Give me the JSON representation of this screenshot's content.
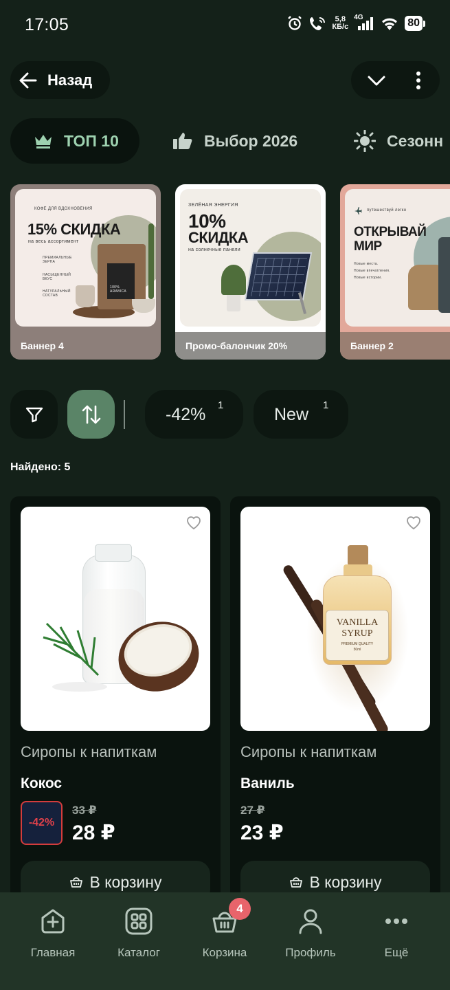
{
  "status_bar": {
    "time": "17:05",
    "net_speed_value": "5,8",
    "net_speed_unit": "КБ/с",
    "network_type": "4G",
    "battery": "80"
  },
  "header": {
    "back_label": "Назад"
  },
  "tabs": [
    {
      "label": "ТОП 10",
      "icon": "crown-icon",
      "active": true
    },
    {
      "label": "Выбор 2026",
      "icon": "thumbs-up-icon",
      "active": false
    },
    {
      "label": "Сезонн",
      "icon": "sun-icon",
      "active": false
    }
  ],
  "banners": [
    {
      "caption": "Баннер 4",
      "art_kicker": "КОФЕ ДЛЯ ВДОХНОВЕНИЯ",
      "art_title": "15% СКИДКА",
      "art_subtitle": "на весь ассортимент",
      "art_features": [
        "ПРЕМИАЛЬНЫЕ ЗЕРНА",
        "НАСЫЩЕННЫЙ ВКУС",
        "НАТУРАЛЬНЫЙ СОСТАВ"
      ],
      "art_bag_text": "100% ARABICA",
      "caption_color": "#8d7f7a"
    },
    {
      "caption": "Промо-балончик 20%",
      "art_kicker": "ЗЕЛЁНАЯ ЭНЕРГИЯ",
      "art_title_line1": "10%",
      "art_title_line2": "СКИДКА",
      "art_subtitle": "на солнечные панели",
      "caption_color": "#8f8e8b"
    },
    {
      "caption": "Баннер 2",
      "art_kicker": "путешествуй легко",
      "art_title_line1": "ОТКРЫВАЙ",
      "art_title_line2": "МИР",
      "art_lines": [
        "Новые места.",
        "Новые впечатления.",
        "Новые истории."
      ],
      "caption_color": "#9a7f72"
    }
  ],
  "filters": {
    "chips": [
      {
        "label": "-42%",
        "count": "1"
      },
      {
        "label": "New",
        "count": "1"
      }
    ]
  },
  "found_text": "Найдено: 5",
  "products": [
    {
      "category": "Сиропы к напиткам",
      "name": "Кокос",
      "discount": "-42%",
      "old_price": "33 ₽",
      "price": "28 ₽",
      "cart_label": "В корзину"
    },
    {
      "category": "Сиропы к напиткам",
      "name": "Ваниль",
      "old_price": "27 ₽",
      "price": "23 ₽",
      "cart_label": "В корзину",
      "label_line1": "VANILLA",
      "label_line2": "SYRUP",
      "label_line3": "PREMIUM QUALITY",
      "label_line4": "50ml"
    }
  ],
  "bottom_nav": {
    "items": [
      {
        "label": "Главная",
        "icon": "home-plus-icon"
      },
      {
        "label": "Каталог",
        "icon": "catalog-grid-icon"
      },
      {
        "label": "Корзина",
        "icon": "basket-icon",
        "badge": "4"
      },
      {
        "label": "Профиль",
        "icon": "profile-icon"
      },
      {
        "label": "Ещё",
        "icon": "more-dots-icon"
      }
    ]
  },
  "colors": {
    "background": "#142119",
    "accent_green": "#5a8467",
    "discount_red": "#e0414a",
    "nav_background": "#223427"
  }
}
